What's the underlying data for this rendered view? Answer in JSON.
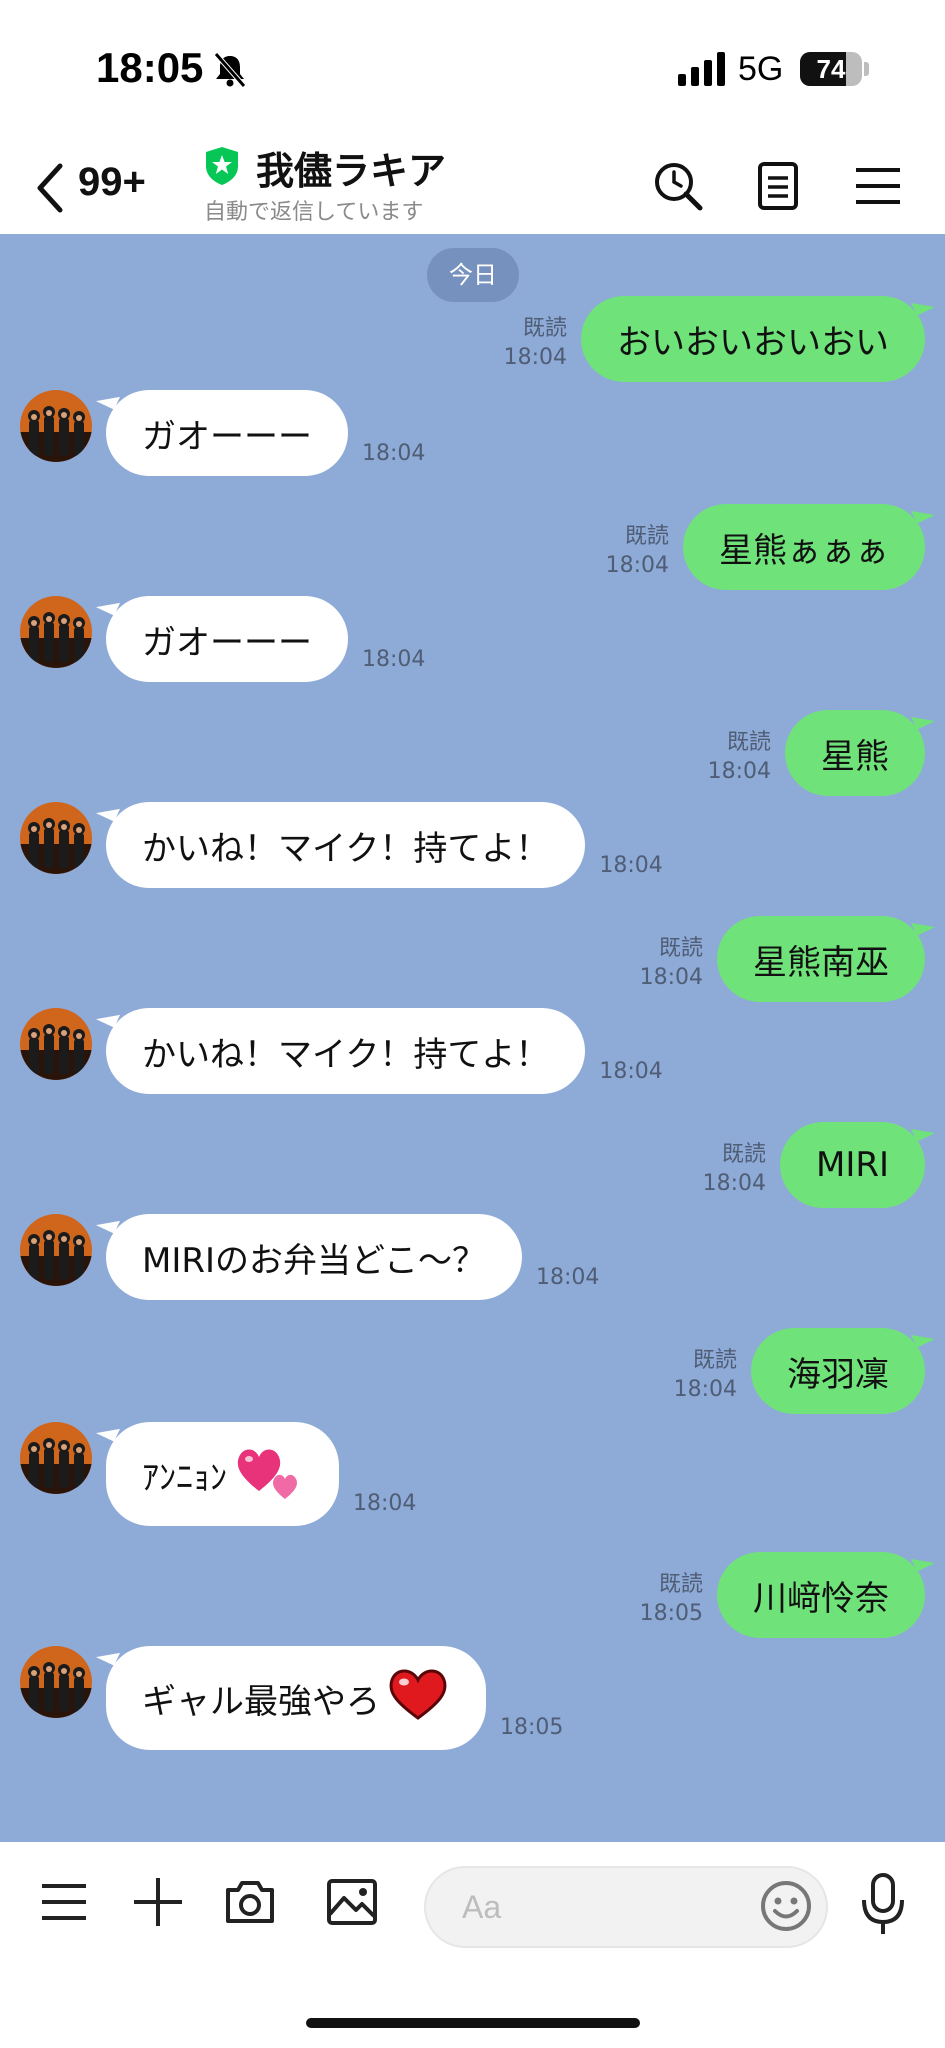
{
  "status_bar": {
    "time": "18:05",
    "network": "5G",
    "battery_pct": "74",
    "battery_level": 0.74
  },
  "header": {
    "back_count": "99+",
    "title": "我儘ラキア",
    "status": "自動で返信しています"
  },
  "chat": {
    "date": "今日",
    "read_label": "既読",
    "messages": [
      {
        "dir": "out",
        "text": "おいおいおいおい",
        "time": "18:04"
      },
      {
        "dir": "in",
        "text": "ガオーーー",
        "time": "18:04"
      },
      {
        "dir": "out",
        "text": "星熊ぁぁぁ",
        "time": "18:04"
      },
      {
        "dir": "in",
        "text": "ガオーーー",
        "time": "18:04"
      },
      {
        "dir": "out",
        "text": "星熊",
        "time": "18:04"
      },
      {
        "dir": "in",
        "text": "かいね！マイク！持てよ！",
        "time": "18:04"
      },
      {
        "dir": "out",
        "text": "星熊南巫",
        "time": "18:04"
      },
      {
        "dir": "in",
        "text": "かいね！マイク！持てよ！",
        "time": "18:04"
      },
      {
        "dir": "out",
        "text": "MIRI",
        "time": "18:04"
      },
      {
        "dir": "in",
        "text": "MIRIのお弁当どこ〜？",
        "time": "18:04"
      },
      {
        "dir": "out",
        "text": "海羽凜",
        "time": "18:04"
      },
      {
        "dir": "in",
        "text": "ｱﾝﾆｮﾝ",
        "time": "18:04",
        "emoji": "double-heart"
      },
      {
        "dir": "out",
        "text": "川﨑怜奈",
        "time": "18:05"
      },
      {
        "dir": "in",
        "text": "ギャル最強やろ",
        "time": "18:05",
        "emoji": "red-heart"
      }
    ]
  },
  "input": {
    "placeholder": "Aa"
  },
  "icons": {
    "header": [
      "search-icon",
      "notes-icon",
      "menu-icon"
    ],
    "bottom": [
      "menu-icon",
      "plus-icon",
      "camera-icon",
      "image-icon",
      "emoji-icon",
      "mic-icon"
    ]
  },
  "colors": {
    "chat_bg": "#8eaad7",
    "outgoing_bubble": "#6fe27a",
    "incoming_bubble": "#ffffff",
    "official_badge": "#06c755"
  }
}
